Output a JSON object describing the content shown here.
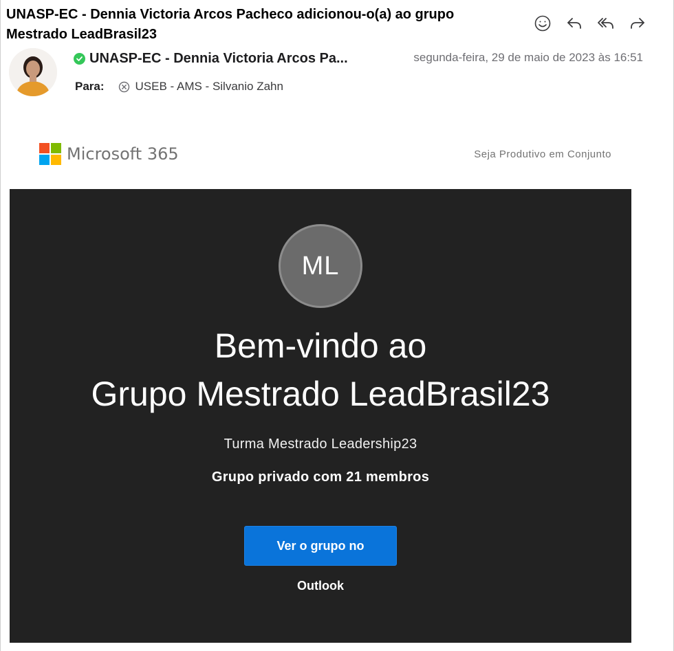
{
  "email": {
    "subject": "UNASP-EC - Dennia Victoria Arcos Pacheco adicionou-o(a) ao grupo Mestrado LeadBrasil23",
    "sender_name": "UNASP-EC - Dennia Victoria Arcos Pa...",
    "date": "segunda-feira, 29 de maio de 2023 às 16:51",
    "to_label": "Para:",
    "recipient": "USEB - AMS - Silvanio Zahn"
  },
  "toolbar": {
    "icons": [
      "emoji-reaction-icon",
      "reply-icon",
      "reply-all-icon",
      "forward-icon"
    ]
  },
  "brand": {
    "name": "Microsoft 365",
    "tagline": "Seja Produtivo em Conjunto",
    "logo_colors": [
      "#f25022",
      "#7fba00",
      "#00a4ef",
      "#ffb900"
    ]
  },
  "group": {
    "initials": "ML",
    "welcome_line1": "Bem-vindo ao",
    "welcome_line2": "Grupo Mestrado LeadBrasil23",
    "description": "Turma Mestrado Leadership23",
    "privacy": "Grupo privado com 21 membros",
    "button_label": "Ver o grupo no",
    "button_sub": "Outlook"
  },
  "colors": {
    "hero_bg": "#222222",
    "button_bg": "#0a74da",
    "verified": "#34c759"
  }
}
